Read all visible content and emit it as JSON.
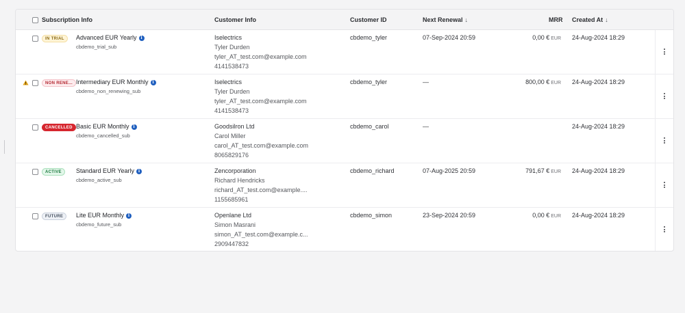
{
  "table": {
    "headers": {
      "subscription_info": "Subscription Info",
      "customer_info": "Customer Info",
      "customer_id": "Customer ID",
      "next_renewal": "Next Renewal",
      "mrr": "MRR",
      "created_at": "Created At"
    },
    "sort_arrow": "↓",
    "rows": [
      {
        "status": "IN TRIAL",
        "status_colors": {
          "bg": "#fff4d6",
          "border": "#f3dfa4",
          "text": "#8a6a14"
        },
        "plan": "Advanced EUR Yearly",
        "sub_id": "cbdemo_trial_sub",
        "company": "Iselectrics",
        "name": "Tyler Durden",
        "email": "tyler_AT_test.com@example.com",
        "phone": "4141538473",
        "customer_id": "cbdemo_tyler",
        "next_renewal": "07-Sep-2024 20:59",
        "mrr_value": "0,00 €",
        "mrr_currency": "EUR",
        "created_at": "24-Aug-2024 18:29",
        "warning": false
      },
      {
        "status": "NON RENE...",
        "status_colors": {
          "bg": "#fdecee",
          "border": "#f3c2c8",
          "text": "#b3262f"
        },
        "plan": "Intermediary EUR Monthly",
        "sub_id": "cbdemo_non_renewing_sub",
        "company": "Iselectrics",
        "name": "Tyler Durden",
        "email": "tyler_AT_test.com@example.com",
        "phone": "4141538473",
        "customer_id": "cbdemo_tyler",
        "next_renewal": "—",
        "mrr_value": "800,00 €",
        "mrr_currency": "EUR",
        "created_at": "24-Aug-2024 18:29",
        "warning": true
      },
      {
        "status": "CANCELLED",
        "status_colors": {
          "bg": "#d6262e",
          "border": "#d6262e",
          "text": "#ffffff"
        },
        "plan": "Basic EUR Monthly",
        "sub_id": "cbdemo_cancelled_sub",
        "company": "Goodsilron Ltd",
        "name": "Carol Miller",
        "email": "carol_AT_test.com@example.com",
        "phone": "8065829176",
        "customer_id": "cbdemo_carol",
        "next_renewal": "—",
        "mrr_value": "",
        "mrr_currency": "",
        "created_at": "24-Aug-2024 18:29",
        "warning": false
      },
      {
        "status": "ACTIVE",
        "status_colors": {
          "bg": "#e3f7ea",
          "border": "#a9dfbb",
          "text": "#1c7a3f"
        },
        "plan": "Standard EUR Yearly",
        "sub_id": "cbdemo_active_sub",
        "company": "Zencorporation",
        "name": "Richard Hendricks",
        "email": "richard_AT_test.com@example....",
        "phone": "1155685961",
        "customer_id": "cbdemo_richard",
        "next_renewal": "07-Aug-2025 20:59",
        "mrr_value": "791,67 €",
        "mrr_currency": "EUR",
        "created_at": "24-Aug-2024 18:29",
        "warning": false
      },
      {
        "status": "FUTURE",
        "status_colors": {
          "bg": "#eef1f6",
          "border": "#c9d0dc",
          "text": "#45505f"
        },
        "plan": "Lite EUR Monthly",
        "sub_id": "cbdemo_future_sub",
        "company": "Openlane Ltd",
        "name": "Simon Masrani",
        "email": "simon_AT_test.com@example.c...",
        "phone": "2909447832",
        "customer_id": "cbdemo_simon",
        "next_renewal": "23-Sep-2024 20:59",
        "mrr_value": "0,00 €",
        "mrr_currency": "EUR",
        "created_at": "24-Aug-2024 18:29",
        "warning": false
      }
    ]
  },
  "icons": {
    "info": "info-icon",
    "menu": "more-vertical-icon",
    "warning": "warning-icon"
  }
}
